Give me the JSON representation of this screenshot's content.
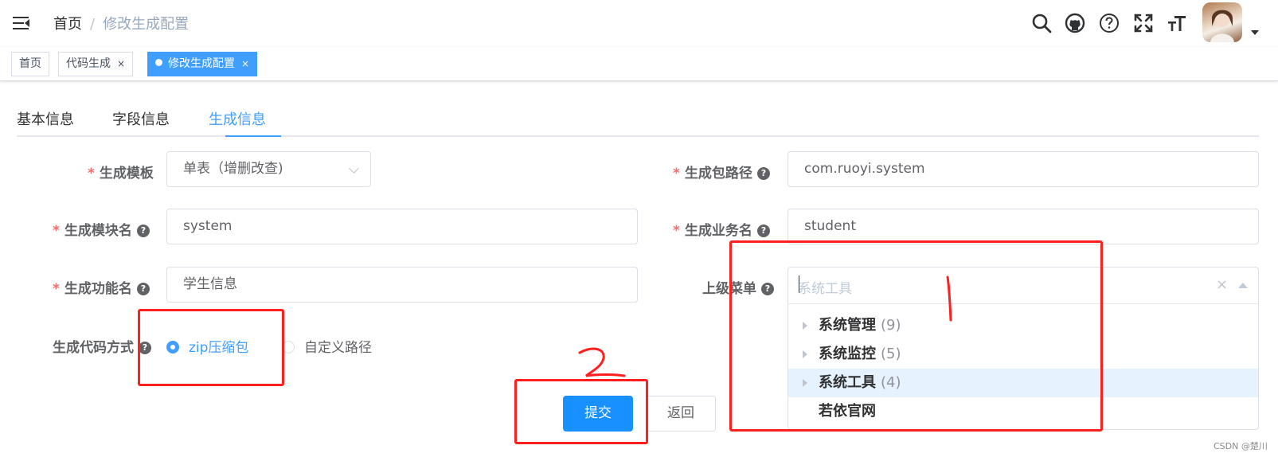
{
  "navbar": {
    "breadcrumb_home": "首页",
    "breadcrumb_sep": "/",
    "breadcrumb_current": "修改生成配置",
    "icons": [
      "search-icon",
      "github-icon",
      "help-icon",
      "fullscreen-icon",
      "font-size-icon"
    ]
  },
  "tags": [
    {
      "label": "首页",
      "closable": false,
      "active": false
    },
    {
      "label": "代码生成",
      "closable": true,
      "active": false
    },
    {
      "label": "修改生成配置",
      "closable": true,
      "active": true
    }
  ],
  "tag_close": "×",
  "tabs": [
    {
      "label": "基本信息",
      "active": false
    },
    {
      "label": "字段信息",
      "active": false
    },
    {
      "label": "生成信息",
      "active": true
    }
  ],
  "form": {
    "tpl_category": {
      "label": "生成模板",
      "value": "单表（增删改查)",
      "required": true
    },
    "package_name": {
      "label": "生成包路径",
      "value": "com.ruoyi.system",
      "required": true
    },
    "module_name": {
      "label": "生成模块名",
      "value": "system",
      "required": true
    },
    "business_name": {
      "label": "生成业务名",
      "value": "student",
      "required": true
    },
    "function_name": {
      "label": "生成功能名",
      "value": "学生信息",
      "required": true
    },
    "parent_menu": {
      "label": "上级菜单",
      "placeholder": "系统工具",
      "required": false
    },
    "gen_type": {
      "label": "生成代码方式",
      "options": [
        {
          "label": "zip压缩包",
          "checked": true
        },
        {
          "label": "自定义路径",
          "checked": false
        }
      ]
    },
    "required_mark": "*",
    "help_mark": "?"
  },
  "tree_options": [
    {
      "name": "系统管理",
      "count": "(9)",
      "has_children": true,
      "highlighted": false
    },
    {
      "name": "系统监控",
      "count": "(5)",
      "has_children": true,
      "highlighted": false
    },
    {
      "name": "系统工具",
      "count": "(4)",
      "has_children": true,
      "highlighted": true
    },
    {
      "name": "若依官网",
      "count": "",
      "has_children": false,
      "highlighted": false
    }
  ],
  "tree_clear": "×",
  "buttons": {
    "submit": "提交",
    "back": "返回"
  },
  "watermark": "CSDN @楚川",
  "colors": {
    "primary": "#409eff",
    "submit": "#1890ff",
    "annotation": "#ff1f1f",
    "required": "#f56c6c"
  }
}
